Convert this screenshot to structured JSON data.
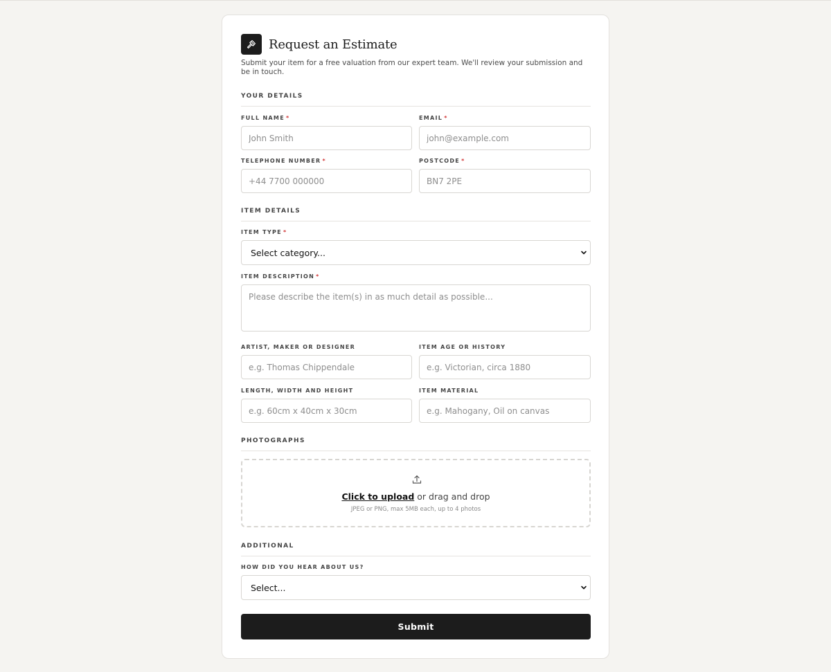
{
  "form": {
    "title": "Request an Estimate",
    "subtitle": "Submit your item for a free valuation from our expert team. We'll review your submission and be in touch.",
    "required_mark": "*"
  },
  "sections": {
    "your_details": "YOUR DETAILS",
    "item_details": "ITEM DETAILS",
    "photographs": "PHOTOGRAPHS",
    "additional": "ADDITIONAL"
  },
  "fields": {
    "full_name": {
      "label": "FULL NAME",
      "placeholder": "John Smith",
      "value": ""
    },
    "email": {
      "label": "EMAIL",
      "placeholder": "john@example.com",
      "value": ""
    },
    "telephone": {
      "label": "TELEPHONE NUMBER",
      "placeholder": "+44 7700 000000",
      "value": ""
    },
    "postcode": {
      "label": "POSTCODE",
      "placeholder": "BN7 2PE",
      "value": ""
    },
    "item_type": {
      "label": "ITEM TYPE",
      "selected": "Select category..."
    },
    "item_description": {
      "label": "ITEM DESCRIPTION",
      "placeholder": "Please describe the item(s) in as much detail as possible...",
      "value": ""
    },
    "artist": {
      "label": "ARTIST, MAKER OR DESIGNER",
      "placeholder": "e.g. Thomas Chippendale",
      "value": ""
    },
    "age": {
      "label": "ITEM AGE OR HISTORY",
      "placeholder": "e.g. Victorian, circa 1880",
      "value": ""
    },
    "dimensions": {
      "label": "LENGTH, WIDTH AND HEIGHT",
      "placeholder": "e.g. 60cm x 40cm x 30cm",
      "value": ""
    },
    "material": {
      "label": "ITEM MATERIAL",
      "placeholder": "e.g. Mahogany, Oil on canvas",
      "value": ""
    },
    "referral": {
      "label": "HOW DID YOU HEAR ABOUT US?",
      "selected": "Select..."
    }
  },
  "upload": {
    "link_text": "Click to upload",
    "rest_text": " or drag and drop",
    "hint": "JPEG or PNG, max 5MB each, up to 4 photos",
    "icon": "upload-icon"
  },
  "submit_label": "Submit",
  "icons": {
    "logo": "gavel-icon",
    "select": "chevron-down-icon"
  },
  "colors": {
    "background": "#f5f4f1",
    "primary": "#1c1c1c",
    "required": "#d23a3a"
  }
}
